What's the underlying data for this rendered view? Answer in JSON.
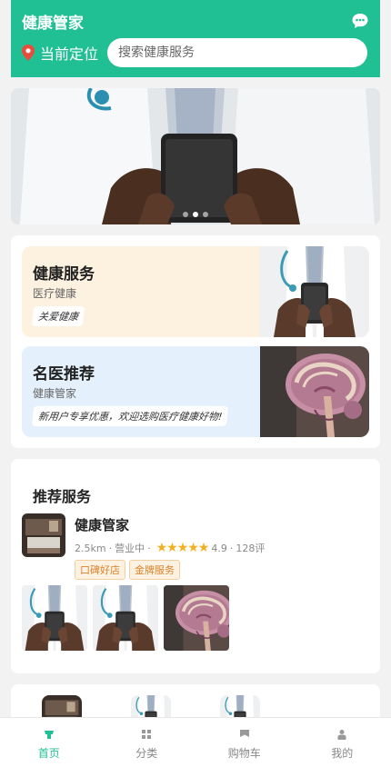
{
  "header": {
    "title": "健康管家",
    "location_label": "当前定位",
    "search_placeholder": "搜索健康服务",
    "bg_color": "#21bf94"
  },
  "banner": {
    "slides_count": 3,
    "active_slide": 1
  },
  "features": [
    {
      "title": "健康服务",
      "subtitle": "医疗健康",
      "tag": "关爱健康",
      "bg": "#fdf1e0",
      "image": "doctor-phone-photo"
    },
    {
      "title": "名医推荐",
      "subtitle": "健康管家",
      "tag": "新用户专享优惠，欢迎选购医疗健康好物!",
      "bg": "#e4f0fb",
      "image": "brain-model-photo"
    }
  ],
  "recommend": {
    "section_title": "推荐服务",
    "store": {
      "name": "健康管家",
      "distance": "2.5km",
      "status": "营业中",
      "separator": "·",
      "rating": "4.9",
      "stars": 5,
      "reviews": "128评",
      "tags": [
        "口碑好店",
        "金牌服务"
      ]
    },
    "gallery": [
      "doctor-phone-photo",
      "doctor-phone-photo",
      "brain-model-photo"
    ]
  },
  "tabs": [
    {
      "label": "首页",
      "icon": "home-icon",
      "active": true
    },
    {
      "label": "分类",
      "icon": "grid-icon",
      "active": false
    },
    {
      "label": "购物车",
      "icon": "cart-icon",
      "active": false
    },
    {
      "label": "我的",
      "icon": "user-icon",
      "active": false
    }
  ],
  "colors": {
    "accent": "#21bf94",
    "star": "#f2b01e",
    "tag_text": "#d9822b"
  }
}
